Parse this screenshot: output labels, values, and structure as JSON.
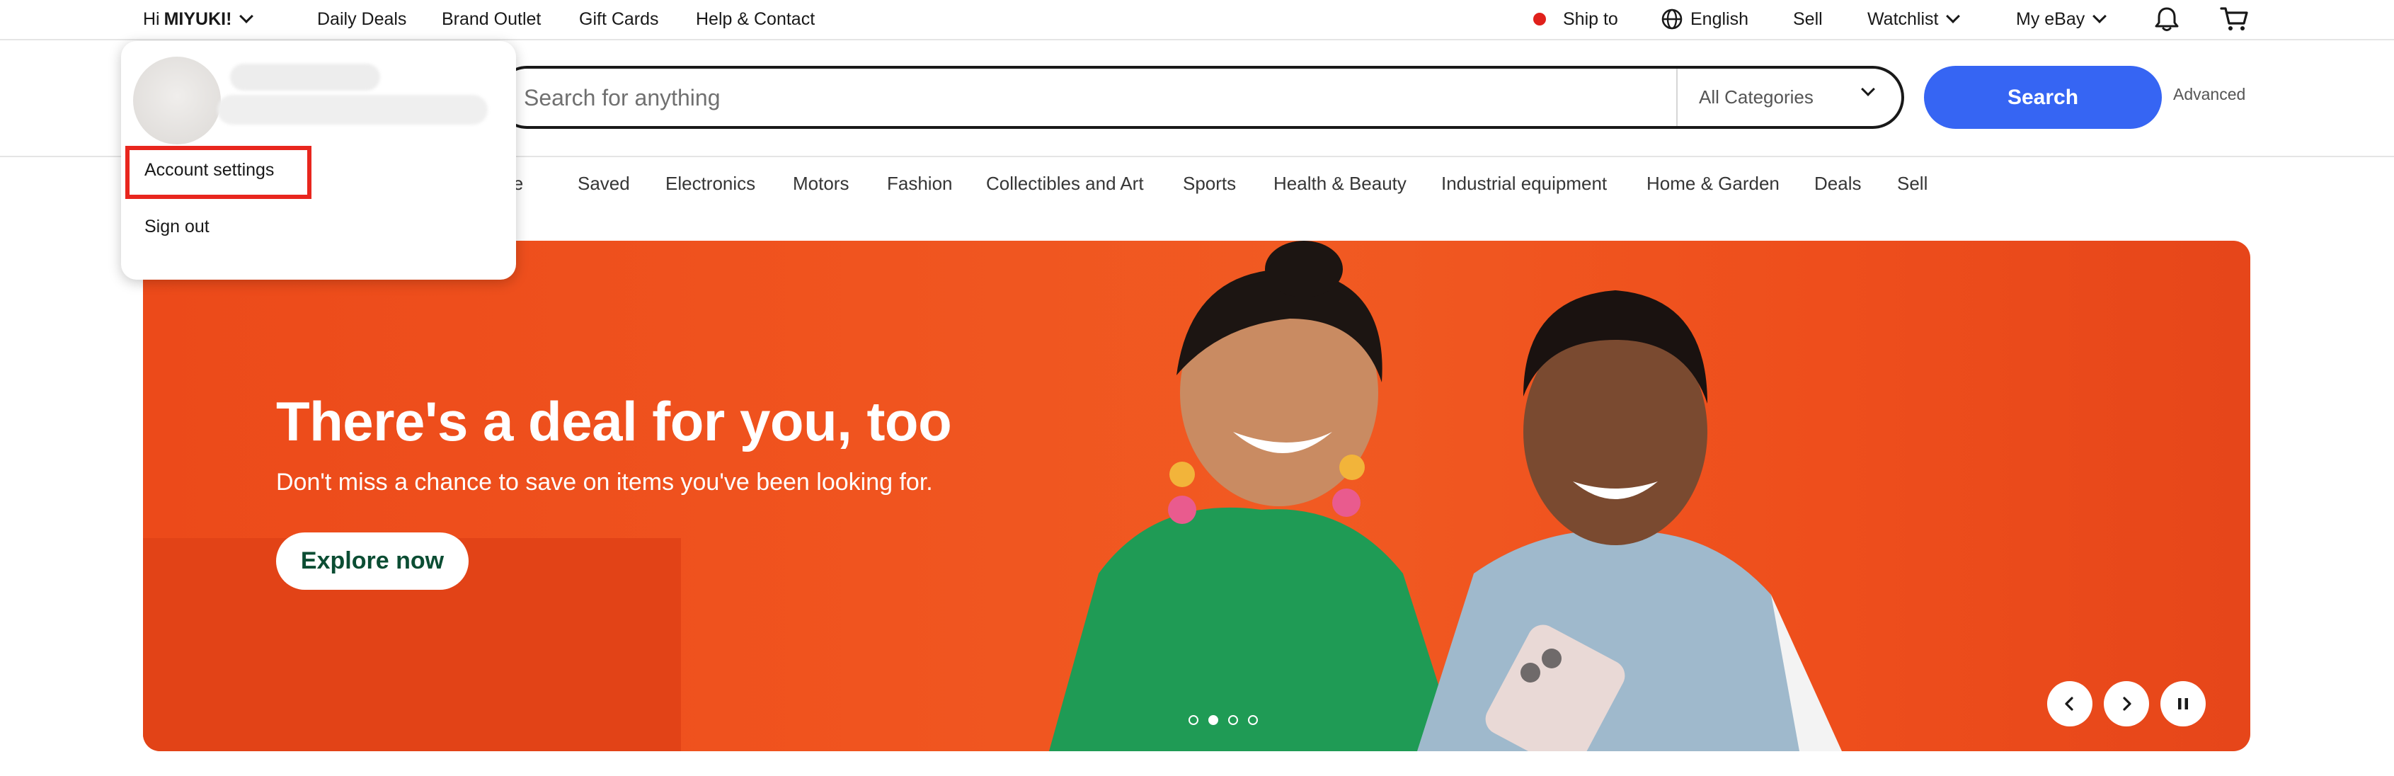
{
  "topbar": {
    "greeting_prefix": "Hi ",
    "user_name": "MIYUKI!",
    "links": [
      "Daily Deals",
      "Brand Outlet",
      "Gift Cards",
      "Help & Contact"
    ],
    "ship_to": "Ship to",
    "language": "English",
    "sell": "Sell",
    "watchlist": "Watchlist",
    "my_ebay": "My eBay"
  },
  "search": {
    "placeholder": "Search for anything",
    "category": "All Categories",
    "button": "Search",
    "advanced": "Advanced"
  },
  "nav": {
    "items": [
      "Saved",
      "Electronics",
      "Motors",
      "Fashion",
      "Collectibles and Art",
      "Sports",
      "Health & Beauty",
      "Industrial equipment",
      "Home & Garden",
      "Deals",
      "Sell"
    ],
    "partial_item": "ive"
  },
  "hero": {
    "title": "There's a deal for you, too",
    "subtitle": "Don't miss a chance to save on items you've been looking for.",
    "cta": "Explore now",
    "slides_count": 4,
    "active_slide": 2
  },
  "dropdown": {
    "account_settings": "Account settings",
    "sign_out": "Sign out"
  },
  "colors": {
    "accent": "#3665f3",
    "hero_bg": "#f0541f",
    "highlight": "#e8261e",
    "cta_text": "#0b4d33"
  },
  "icons": [
    "chevron-down-icon",
    "ship-to-dot-icon",
    "globe-icon",
    "bell-icon",
    "cart-icon",
    "chevron-left-icon",
    "chevron-right-icon",
    "pause-icon"
  ]
}
